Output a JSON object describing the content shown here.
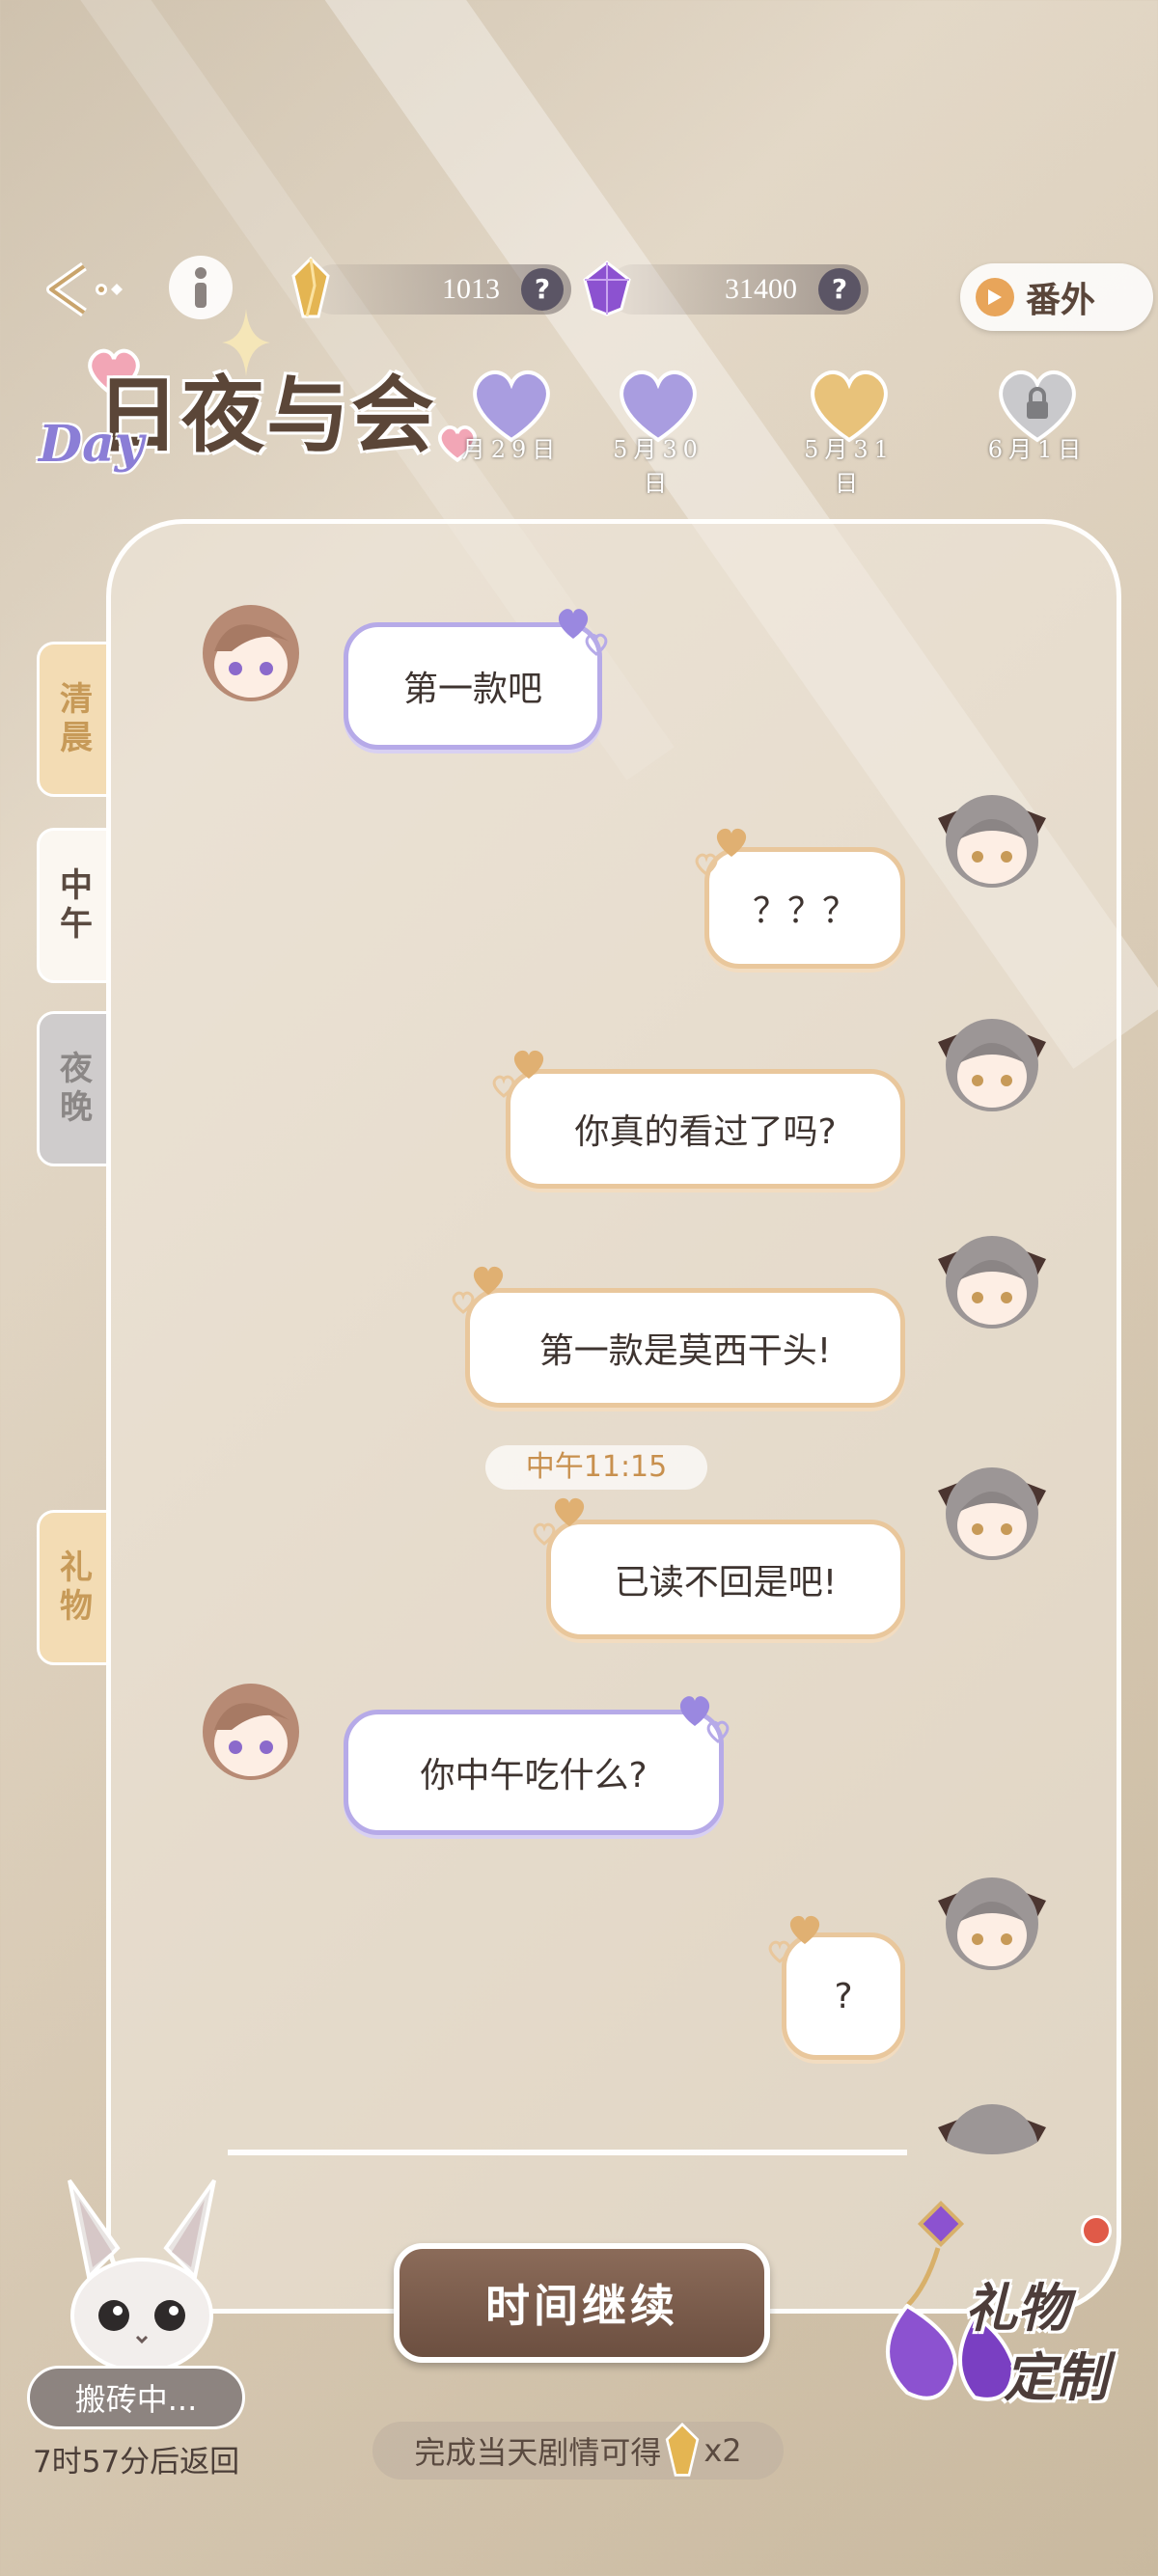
{
  "header": {
    "back_icon": "back-arrow-icon",
    "info_icon": "info-icon",
    "currency_gold": "1013",
    "currency_purple": "31400",
    "help_symbol": "?",
    "extra_button_label": "番外"
  },
  "logo": {
    "day_text": "Day",
    "title": "日夜与会"
  },
  "dates": [
    {
      "label": "月29日",
      "color": "#a99de0",
      "locked": false
    },
    {
      "label": "5月30日",
      "color": "#a99de0",
      "locked": false
    },
    {
      "label": "5月31日",
      "color": "#e8c27a",
      "locked": false
    },
    {
      "label": "6月1日",
      "color": "#c9c9cc",
      "locked": true
    }
  ],
  "side_tabs": {
    "morning": "清晨",
    "noon": "中午",
    "evening": "夜晚",
    "gift": "礼物"
  },
  "chat": {
    "messages": [
      {
        "side": "left",
        "text": "第一款吧"
      },
      {
        "side": "right",
        "text": "？？？"
      },
      {
        "side": "right",
        "text": "你真的看过了吗?"
      },
      {
        "side": "right",
        "text": "第一款是莫西干头!"
      },
      {
        "side": "right",
        "text": "已读不回是吧!"
      },
      {
        "side": "left",
        "text": "你中午吃什么?"
      },
      {
        "side": "right",
        "text": "?"
      }
    ],
    "timestamp": "中午11:15"
  },
  "bottom": {
    "continue_label": "时间继续",
    "reward_text": "完成当天剧情可得",
    "reward_multiplier": "x2",
    "working_label": "搬砖中...",
    "return_text": "7时57分后返回",
    "gift_custom_line1": "礼物",
    "gift_custom_line2": "定制"
  }
}
